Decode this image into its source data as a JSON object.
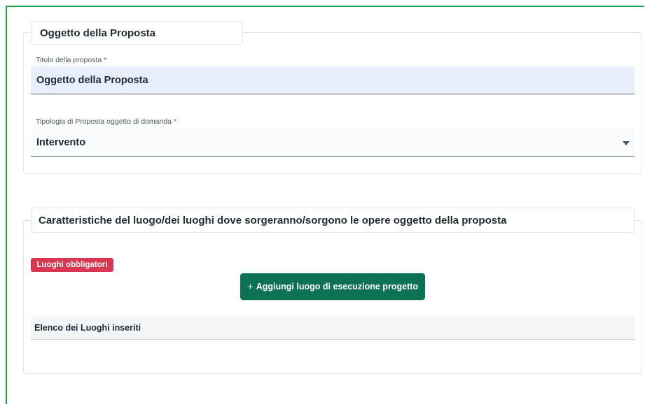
{
  "section1": {
    "legend": "Oggetto della Proposta",
    "title_field": {
      "label": "Titolo della proposta",
      "required_mark": "*",
      "value": "Oggetto della Proposta"
    },
    "type_field": {
      "label": "Tipologia di Proposta oggetto di domanda",
      "required_mark": "*",
      "value": "Intervento",
      "icon": "caret-down-icon"
    }
  },
  "section2": {
    "legend": "Caratteristiche del luogo/dei luoghi dove sorgeranno/sorgono le opere oggetto della proposta",
    "badge": "Luoghi obbligatori",
    "add_button": {
      "icon": "+",
      "label": "Aggiungi luogo di esecuzione progetto"
    },
    "list_header": "Elenco dei Luoghi inseriti"
  },
  "colors": {
    "accent": "#0c7253",
    "danger": "#d9364f",
    "frame": "#1ea64a",
    "input_fill": "#e8eefa"
  }
}
